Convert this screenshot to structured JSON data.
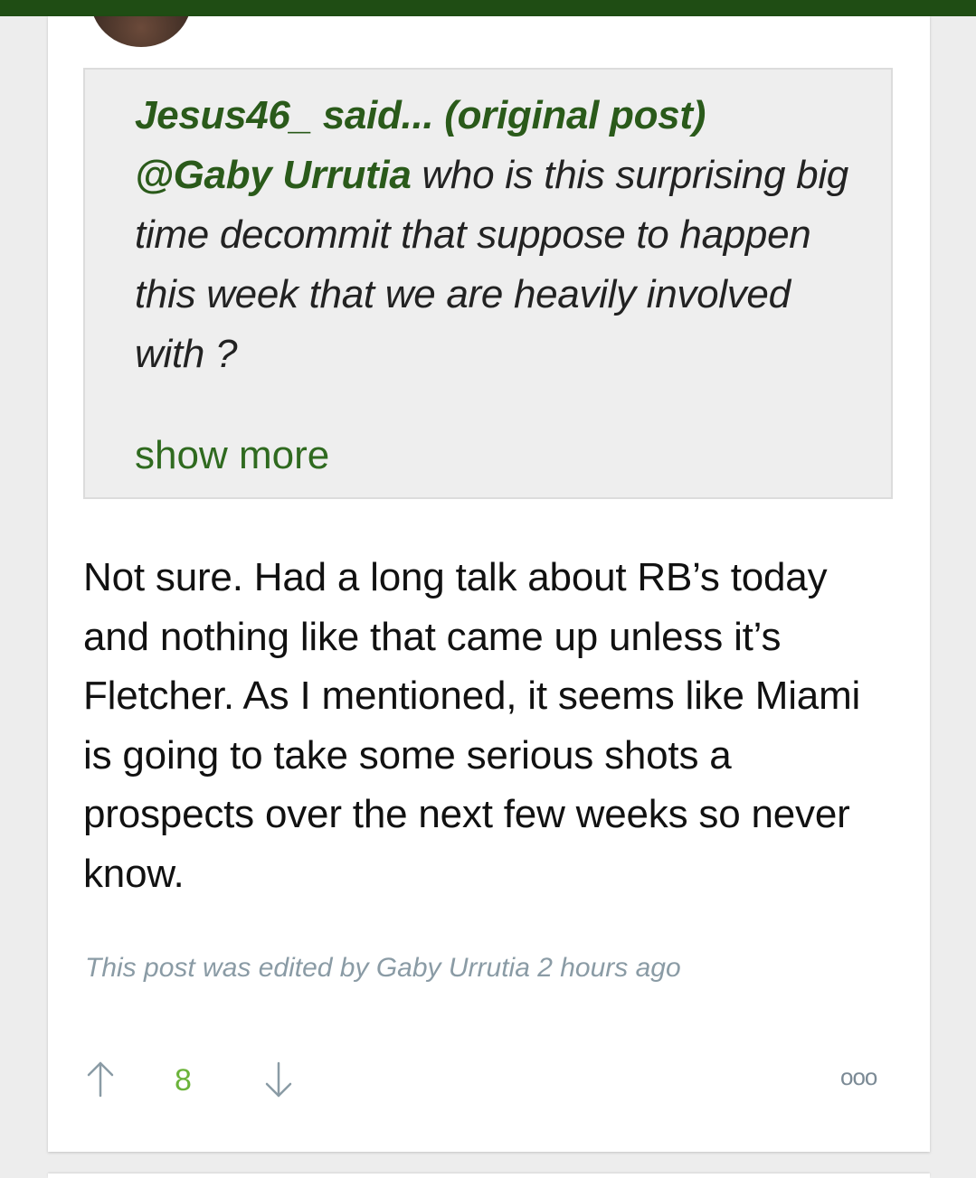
{
  "quote": {
    "author": "Jesus46_ said... (original post)",
    "mention": "@Gaby Urrutia",
    "text": " who is this surprising big time decommit that suppose to happen this week that we are heavily involved with ?",
    "show_more_label": "show more"
  },
  "post": {
    "body": "Not sure. Had a long talk about RB’s today and nothing like that came up unless it’s Fletcher. As I mentioned, it seems like Miami is going to take some serious shots a prospects over the next few weeks so never know.",
    "edited_note": "This post was edited by Gaby Urrutia 2 hours ago"
  },
  "votes": {
    "count": "8",
    "up_icon": "arrow-up-icon",
    "down_icon": "arrow-down-icon",
    "more_label": "ooo"
  },
  "colors": {
    "header_bar": "#1f4d14",
    "accent_green": "#2a5a1a",
    "vote_green": "#6bb33a",
    "muted_gray": "#8a9ba5"
  }
}
